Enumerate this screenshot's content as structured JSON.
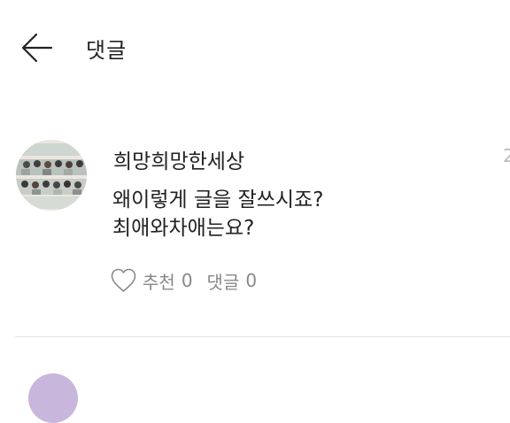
{
  "header": {
    "back_icon": "arrow-left-icon",
    "title": "댓글"
  },
  "comment": {
    "username": "희망희망한세상",
    "timestamp": "2",
    "lines": [
      "왜이렇게 글을 잘쓰시죠?",
      "최애와차애는요?"
    ],
    "actions": {
      "like_icon": "heart-outline-icon",
      "like_label": "추천",
      "like_count": "0",
      "reply_label": "댓글",
      "reply_count": "0"
    }
  },
  "colors": {
    "text": "#222222",
    "muted": "#888888",
    "divider": "#e6e6e6",
    "next_avatar": "#c9b6dc"
  }
}
